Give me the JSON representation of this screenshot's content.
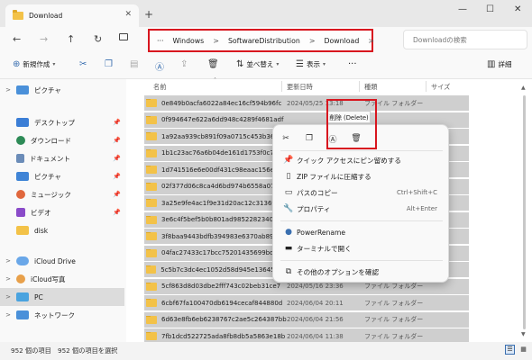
{
  "window": {
    "tab_title": "Download",
    "tab_close": "✕",
    "new_tab": "+",
    "minimize": "—",
    "maximize": "☐",
    "close": "✕"
  },
  "nav": {
    "back": "←",
    "forward": "→",
    "up": "↑",
    "refresh": "↻",
    "breadcrumb": [
      "Windows",
      "SoftwareDistribution",
      "Download"
    ],
    "more": "···",
    "separator": ">",
    "search_placeholder": "Downloadの検索"
  },
  "toolbar": {
    "new_label": "新規作成",
    "sort_label": "並べ替え",
    "view_label": "表示",
    "more_label": "···",
    "details_label": "詳細"
  },
  "sidebar": {
    "items": [
      {
        "label": "ピクチャ",
        "chevron": ">",
        "pinned": false,
        "color": "#4a90d9"
      },
      {
        "label": "デスクトップ",
        "chevron": "",
        "pinned": true,
        "color": "#3b7ed6"
      },
      {
        "label": "ダウンロード",
        "chevron": "",
        "pinned": true,
        "color": "#2e8b57"
      },
      {
        "label": "ドキュメント",
        "chevron": "",
        "pinned": true,
        "color": "#6b8cb8"
      },
      {
        "label": "ピクチャ",
        "chevron": "",
        "pinned": true,
        "color": "#3f84d6"
      },
      {
        "label": "ミュージック",
        "chevron": "",
        "pinned": true,
        "color": "#e0673d"
      },
      {
        "label": "ビデオ",
        "chevron": "",
        "pinned": true,
        "color": "#8a4bc9"
      },
      {
        "label": "disk",
        "chevron": "",
        "pinned": false,
        "color": "#f3c248"
      },
      {
        "label": "iCloud Drive",
        "chevron": ">",
        "pinned": false,
        "color": "#6aa7e8"
      },
      {
        "label": "iCloud写真",
        "chevron": ">",
        "pinned": false,
        "color": "#e8a04a"
      },
      {
        "label": "PC",
        "chevron": ">",
        "pinned": false,
        "color": "#4aa3df"
      },
      {
        "label": "ネットワーク",
        "chevron": ">",
        "pinned": false,
        "color": "#4a90d9"
      }
    ]
  },
  "columns": {
    "name": "名前",
    "date": "更新日時",
    "type": "種類",
    "size": "サイズ"
  },
  "rows": [
    {
      "name": "0e849b0acfa6022a84ec16cf594b96fc",
      "date": "2024/05/25 13:18",
      "type": "ファイル フォルダー"
    },
    {
      "name": "0f994647e622a6dd948c4289f4681adf",
      "date": "",
      "type": ""
    },
    {
      "name": "1a92aa939cb891f09a0715c453b36b86",
      "date": "",
      "type": ""
    },
    {
      "name": "1b1c23ac76a6b04de161d1753f0c7dd7",
      "date": "",
      "type": ""
    },
    {
      "name": "1d741516e6e00df431c98eaac156e9b9",
      "date": "",
      "type": ""
    },
    {
      "name": "02f377d06c8ca4d6bd974b6558a07d79",
      "date": "",
      "type": ""
    },
    {
      "name": "3a25e9fe4ac1f9e31d20ac12c3136fac",
      "date": "",
      "type": ""
    },
    {
      "name": "3e6c4f5bef5b0b801ad9852282340e2c",
      "date": "",
      "type": ""
    },
    {
      "name": "3f8baa9443bdfb394983e6370ab89a48",
      "date": "",
      "type": ""
    },
    {
      "name": "04fac27433c17bcc75201435699bde71",
      "date": "",
      "type": ""
    },
    {
      "name": "5c5b7c3dc4ec1052d58d945e1364569d",
      "date": "",
      "type": ""
    },
    {
      "name": "5cf863d8d03dbe2fff743c02beb31ce7",
      "date": "2024/05/16 23:36",
      "type": "ファイル フォルダー"
    },
    {
      "name": "6cbf67fa100470db6194cecaf844880d",
      "date": "2024/06/04 20:11",
      "type": "ファイル フォルダー"
    },
    {
      "name": "6d63e8fb6eb6238767c2ae5c264387bb",
      "date": "2024/06/04 21:56",
      "type": "ファイル フォルダー"
    },
    {
      "name": "7fb1dcd522725ada8fb8db5a5863e18b",
      "date": "2024/06/04 11:38",
      "type": "ファイル フォルダー"
    }
  ],
  "context_menu": {
    "tooltip": "削除 (Delete)",
    "icons": [
      "cut",
      "copy",
      "rename",
      "delete"
    ],
    "items": [
      {
        "label": "クイック アクセスにピン留めする",
        "shortcut": ""
      },
      {
        "label": "ZIP ファイルに圧縮する",
        "shortcut": ""
      },
      {
        "label": "パスのコピー",
        "shortcut": "Ctrl+Shift+C"
      },
      {
        "label": "プロパティ",
        "shortcut": "Alt+Enter"
      },
      {
        "label": "PowerRename",
        "shortcut": ""
      },
      {
        "label": "ターミナルで開く",
        "shortcut": ""
      },
      {
        "label": "その他のオプションを確認",
        "shortcut": ""
      }
    ]
  },
  "status": {
    "count": "952 個の項目",
    "selected": "952 個の項目を選択"
  }
}
